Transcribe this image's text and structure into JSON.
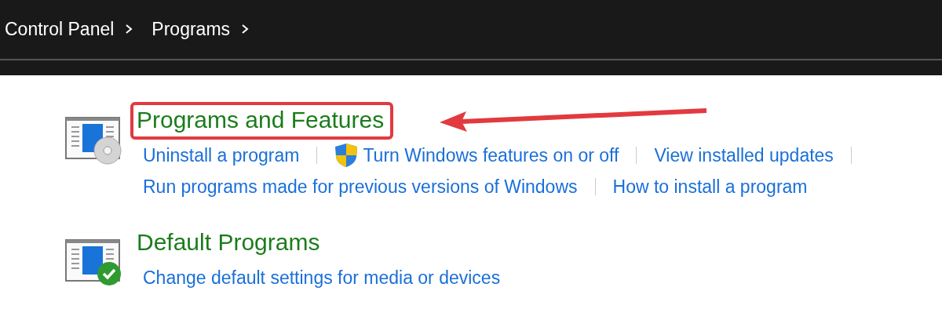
{
  "breadcrumb": [
    "Control Panel",
    "Programs"
  ],
  "sections": [
    {
      "title": "Programs and Features",
      "kind": "disc",
      "highlighted": true,
      "link_rows": [
        [
          {
            "label": "Uninstall a program",
            "kind": "plain"
          },
          {
            "label": "Turn Windows features on or off",
            "kind": "shield"
          },
          {
            "label": "View installed updates",
            "kind": "plain"
          }
        ],
        [
          {
            "label": "Run programs made for previous versions of Windows",
            "kind": "plain"
          },
          {
            "label": "How to install a program",
            "kind": "plain"
          }
        ]
      ]
    },
    {
      "title": "Default Programs",
      "kind": "check",
      "highlighted": false,
      "link_rows": [
        [
          {
            "label": "Change default settings for media or devices",
            "kind": "plain"
          }
        ]
      ]
    }
  ]
}
